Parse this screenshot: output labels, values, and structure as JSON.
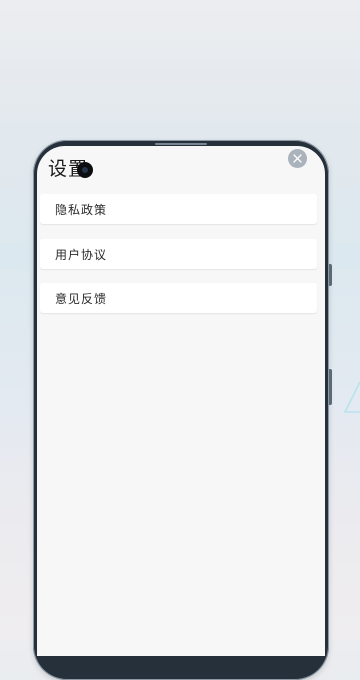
{
  "settings": {
    "title": "设置",
    "close_icon": "close-icon",
    "menu": [
      {
        "label": "隐私政策"
      },
      {
        "label": "用户协议"
      },
      {
        "label": "意见反馈"
      }
    ]
  },
  "colors": {
    "accent_light_blue": "#b9e2ef",
    "close_button": "#aab3bb",
    "screen_background": "#f7f7f7"
  }
}
